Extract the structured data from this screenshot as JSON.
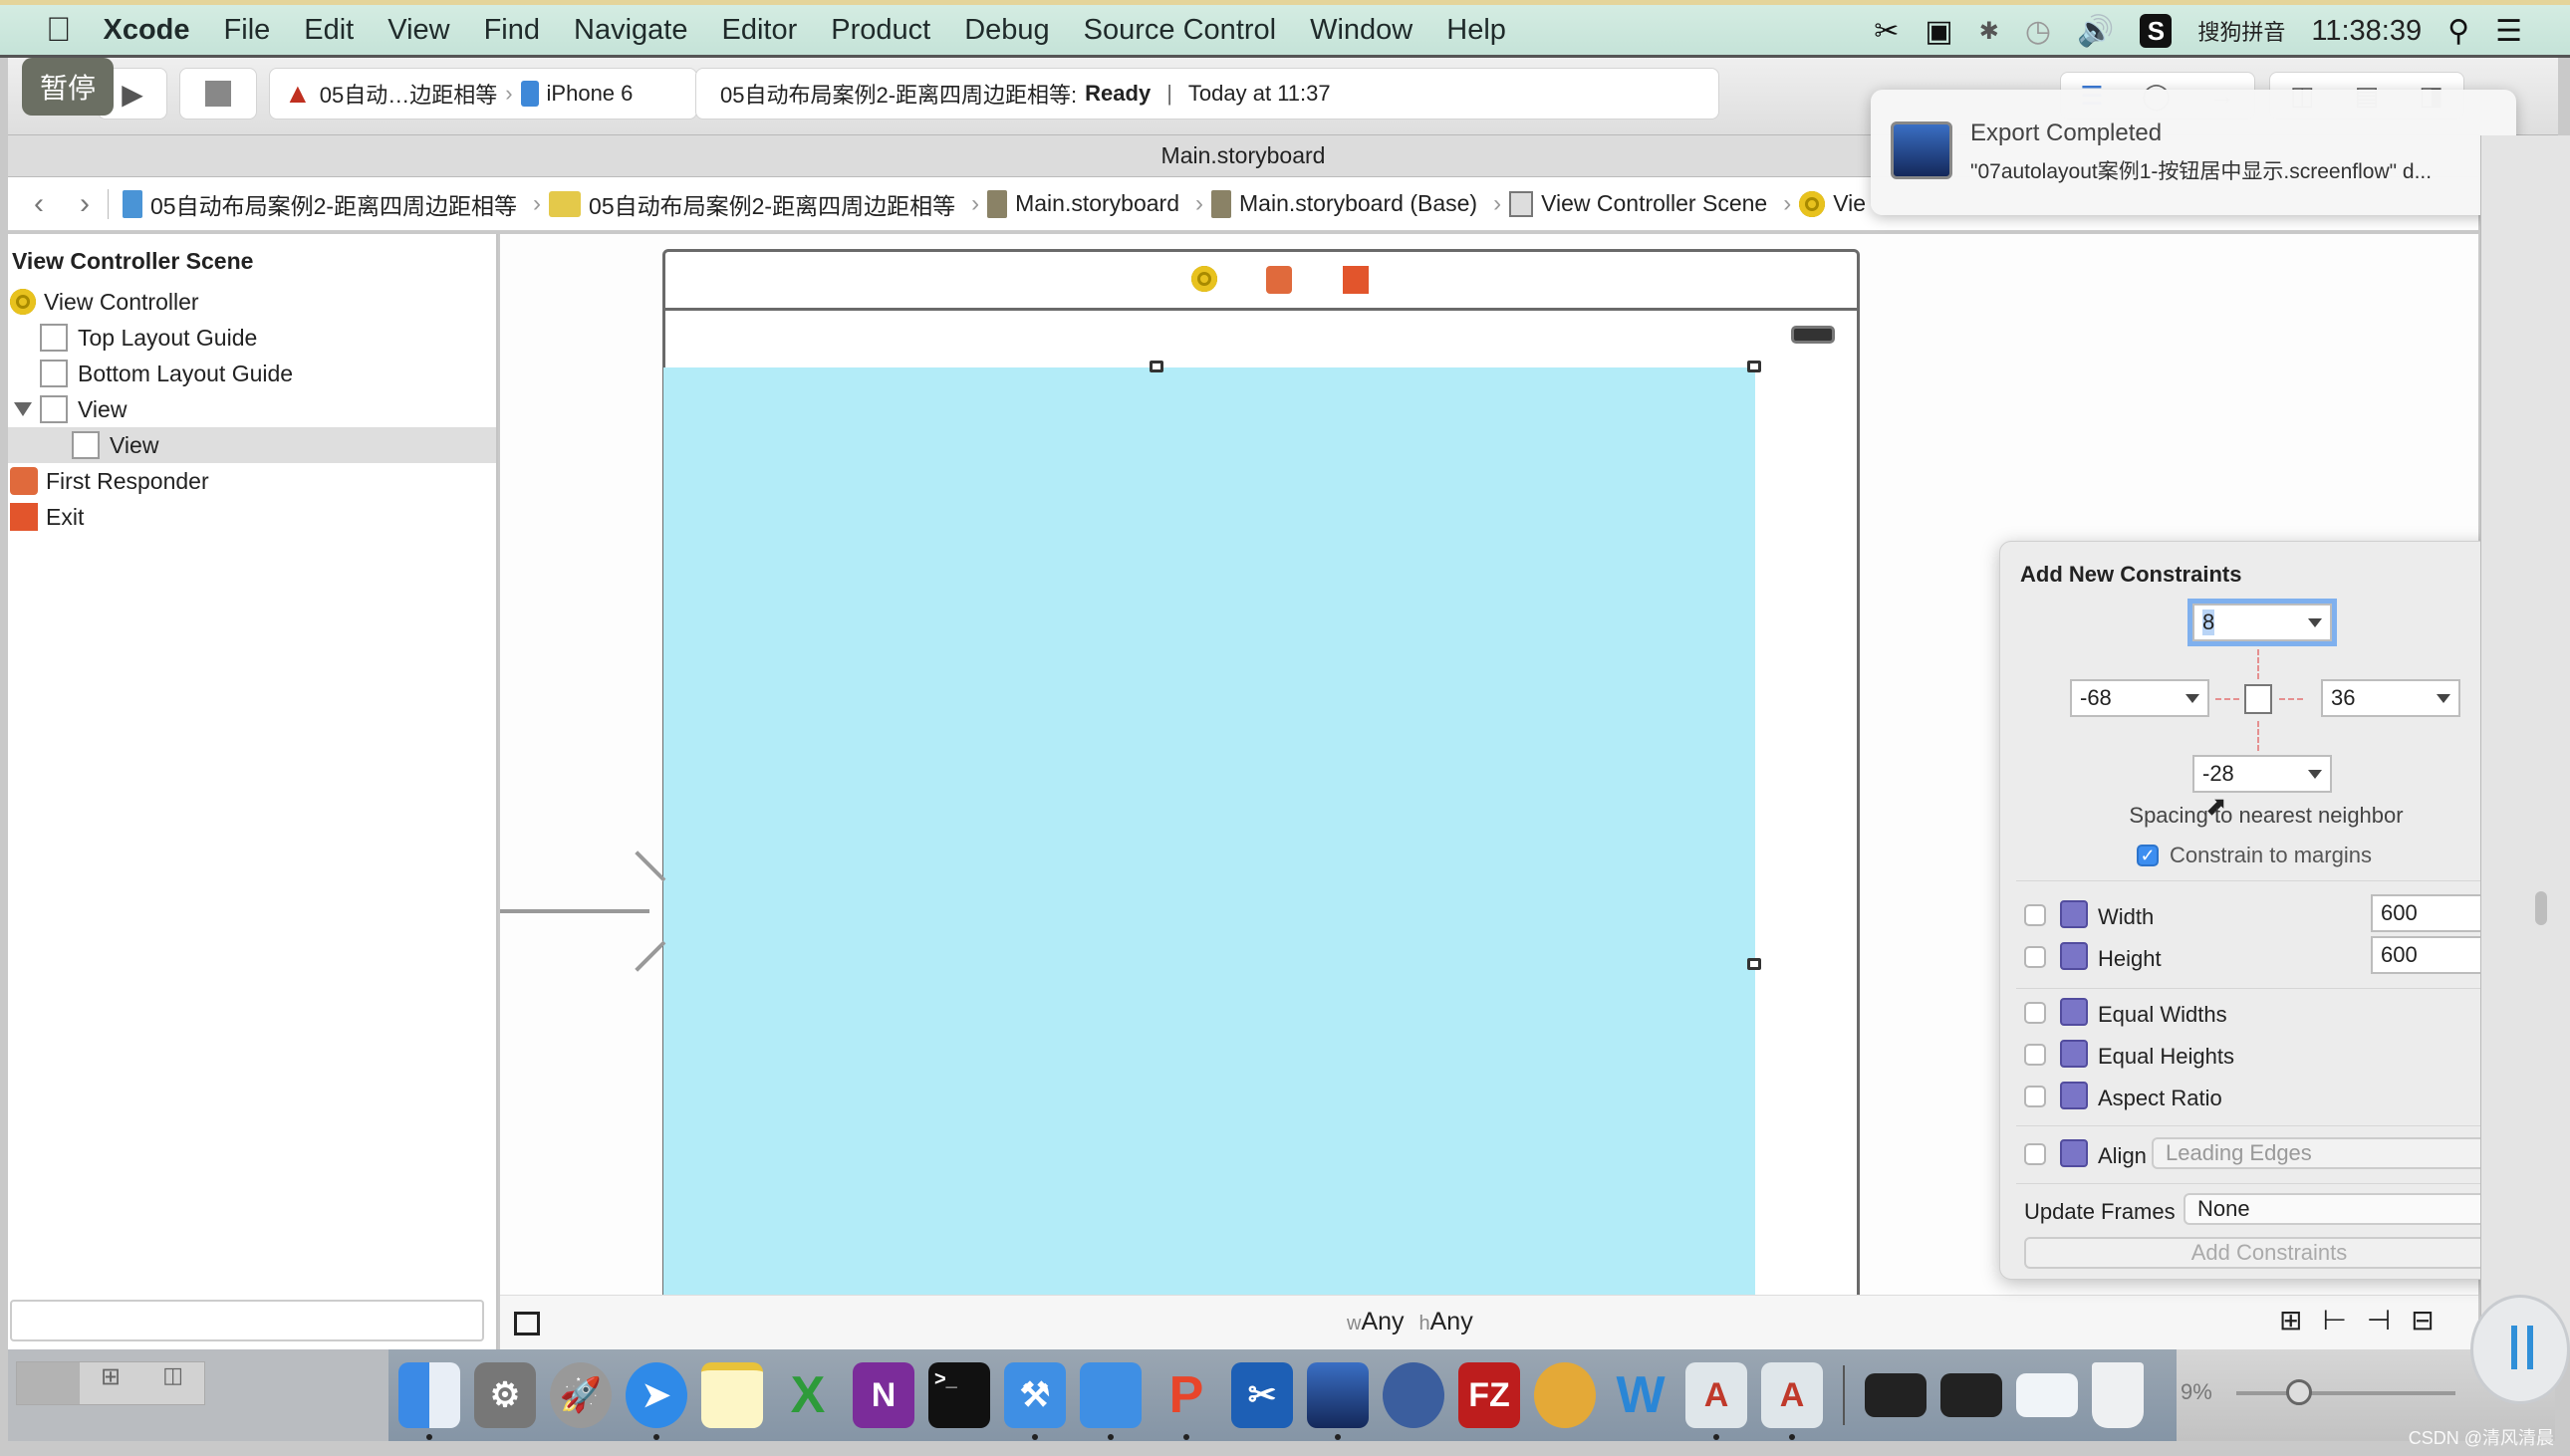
{
  "menubar": {
    "app": "Xcode",
    "items": [
      "File",
      "Edit",
      "View",
      "Find",
      "Navigate",
      "Editor",
      "Product",
      "Debug",
      "Source Control",
      "Window",
      "Help"
    ],
    "status": {
      "input_method": "搜狗拼音",
      "clock": "11:38:39"
    }
  },
  "toolbar": {
    "pause_badge": "暂停",
    "scheme": "05自动…边距相等",
    "device": "iPhone 6",
    "activity_project": "05自动布局案例2-距离四周边距相等:",
    "activity_status": "Ready",
    "activity_time": "Today at 11:37"
  },
  "tab_title": "Main.storyboard",
  "jumpbar": {
    "crumbs": [
      {
        "label": "05自动布局案例2-距离四周边距相等",
        "icon": "project-icon"
      },
      {
        "label": "05自动布局案例2-距离四周边距相等",
        "icon": "folder-icon"
      },
      {
        "label": "Main.storyboard",
        "icon": "storyboard-icon"
      },
      {
        "label": "Main.storyboard (Base)",
        "icon": "storyboard-icon"
      },
      {
        "label": "View Controller Scene",
        "icon": "scene-icon"
      },
      {
        "label": "Vie",
        "icon": "view-controller-icon"
      }
    ]
  },
  "outline": {
    "header": "View Controller Scene",
    "rows": [
      {
        "label": "View Controller",
        "icon": "view-controller-icon",
        "indent": 0
      },
      {
        "label": "Top Layout Guide",
        "icon": "layout-guide-icon",
        "indent": 1
      },
      {
        "label": "Bottom Layout Guide",
        "icon": "layout-guide-icon",
        "indent": 1
      },
      {
        "label": "View",
        "icon": "view-icon",
        "indent": 1,
        "expanded": true
      },
      {
        "label": "View",
        "icon": "view-icon",
        "indent": 2,
        "selected": true
      },
      {
        "label": "First Responder",
        "icon": "first-responder-icon",
        "indent": 0
      },
      {
        "label": "Exit",
        "icon": "exit-icon",
        "indent": 0
      }
    ]
  },
  "canvas": {
    "size_class_w": "w",
    "size_class_w_val": "Any",
    "size_class_h": "h",
    "size_class_h_val": "Any",
    "view_color": "#b3ecf8"
  },
  "constraints_popover": {
    "title": "Add New Constraints",
    "top": "8",
    "leading": "-68",
    "trailing": "36",
    "bottom": "-28",
    "spacing_label": "Spacing to nearest neighbor",
    "constrain_margins_label": "Constrain to margins",
    "constrain_margins_checked": true,
    "width_label": "Width",
    "width_value": "600",
    "height_label": "Height",
    "height_value": "600",
    "equal_widths": "Equal Widths",
    "equal_heights": "Equal Heights",
    "aspect_ratio": "Aspect Ratio",
    "align_label": "Align",
    "align_value": "Leading Edges",
    "update_frames_label": "Update Frames",
    "update_frames_value": "None",
    "add_button": "Add Constraints"
  },
  "notification": {
    "title": "Export Completed",
    "body": "\"07autolayout案例1-按钮居中显示.screenflow\" d..."
  },
  "dock": {
    "zoom_percent": "9%",
    "apps": [
      "Finder",
      "System Preferences",
      "Launchpad",
      "Safari",
      "Notes",
      "Excel",
      "OneNote",
      "Terminal",
      "Xcode",
      "Simulator",
      "Paw",
      "Scissors",
      "ScreenFlow",
      "FTP",
      "FileZilla",
      "Sketch",
      "Word",
      "Instruments",
      "Instruments",
      "Screen",
      "Screen",
      "Preview",
      "Trash"
    ]
  },
  "watermark": "CSDN @清风清晨"
}
